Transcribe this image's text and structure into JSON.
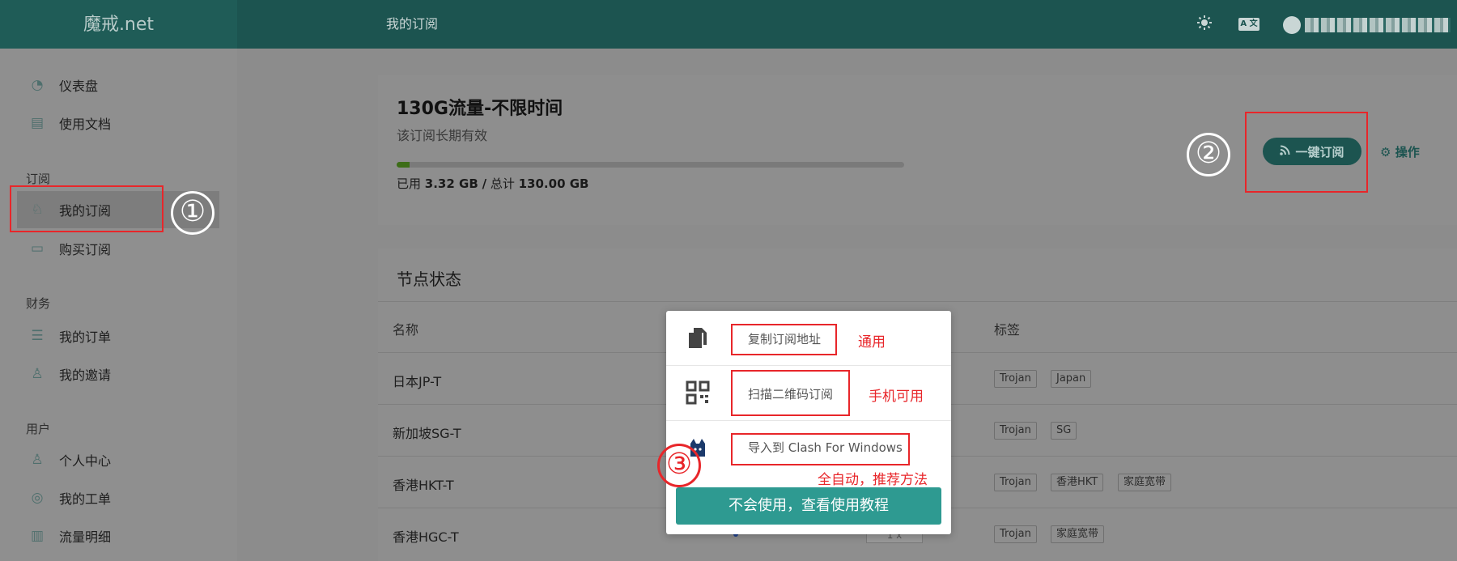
{
  "header": {
    "brand": "魔戒.net",
    "page_title": "我的订阅",
    "lang_icon_label": "A 文"
  },
  "sidebar": {
    "items_top": [
      {
        "label": "仪表盘",
        "icon": "dashboard-icon"
      },
      {
        "label": "使用文档",
        "icon": "book-icon"
      }
    ],
    "group_subscribe": "订阅",
    "items_subscribe": [
      {
        "label": "我的订阅",
        "icon": "bell-icon",
        "active": true
      },
      {
        "label": "购买订阅",
        "icon": "clipboard-icon"
      }
    ],
    "group_finance": "财务",
    "items_finance": [
      {
        "label": "我的订单",
        "icon": "list-icon"
      },
      {
        "label": "我的邀请",
        "icon": "user-invite-icon"
      }
    ],
    "group_user": "用户",
    "items_user": [
      {
        "label": "个人中心",
        "icon": "user-icon"
      },
      {
        "label": "我的工单",
        "icon": "support-icon"
      },
      {
        "label": "流量明细",
        "icon": "bar-chart-icon"
      }
    ]
  },
  "subscription": {
    "title": "130G流量-不限时间",
    "subtitle": "该订阅长期有效",
    "used_prefix": "已用",
    "used_value": "3.32 GB",
    "separator": "/",
    "total_prefix": "总计",
    "total_value": "130.00 GB",
    "usage_fraction": 0.0255,
    "subscribe_button": "一键订阅",
    "ops_button": "操作"
  },
  "nodes": {
    "title": "节点状态",
    "col_name": "名称",
    "col_tags": "标签",
    "rows": [
      {
        "name": "日本JP-T",
        "tags": [
          "Trojan",
          "Japan"
        ]
      },
      {
        "name": "新加坡SG-T",
        "tags": [
          "Trojan",
          "SG"
        ]
      },
      {
        "name": "香港HKT-T",
        "tags": [
          "Trojan",
          "香港HKT",
          "家庭宽带"
        ]
      },
      {
        "name": "香港HGC-T",
        "tags": [
          "Trojan",
          "家庭宽带"
        ]
      }
    ],
    "rate_partial": "1 x"
  },
  "popup": {
    "copy_label": "复制订阅地址",
    "qr_label": "扫描二维码订阅",
    "clash_label": "导入到 Clash For Windows",
    "tutorial_button": "不会使用，查看使用教程"
  },
  "annotations": {
    "note_copy": "通用",
    "note_qr": "手机可用",
    "note_clash": "全自动，推荐方法",
    "num1": "①",
    "num2": "②",
    "num3": "③"
  },
  "colors": {
    "header": "#1c5450",
    "accent": "#2e9a91",
    "annotation": "#e8262a"
  }
}
